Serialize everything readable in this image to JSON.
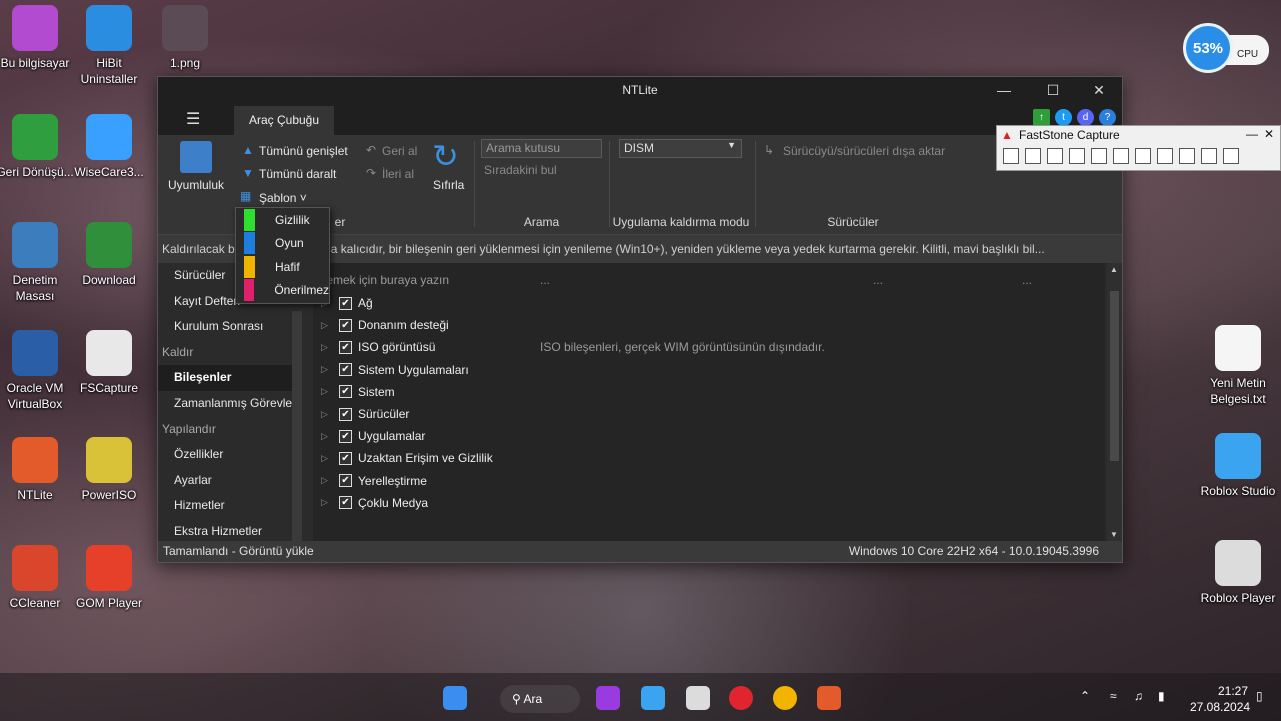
{
  "desktop_icons_left": [
    {
      "label": "Bu bilgisayar",
      "color": "#b34bd1",
      "icon": "monitor-icon"
    },
    {
      "label": "HiBit Uninstaller",
      "color": "#2a8de0",
      "icon": "hibit-icon"
    },
    {
      "label": "1.png",
      "color": "#5b4b55",
      "icon": "image-file-icon"
    },
    {
      "label": "Geri Dönüşü...",
      "color": "#2e9e3e",
      "icon": "recycle-bin-icon"
    },
    {
      "label": "WiseCare3...",
      "color": "#3aa0ff",
      "icon": "wisecare-icon"
    },
    {
      "label": "Denetim Masası",
      "color": "#3c7dbd",
      "icon": "control-panel-icon"
    },
    {
      "label": "Download",
      "color": "#2f8f3a",
      "icon": "download-icon"
    },
    {
      "label": "Oracle VM VirtualBox",
      "color": "#2a5fa8",
      "icon": "virtualbox-icon"
    },
    {
      "label": "FSCapture",
      "color": "#e8e8e8",
      "icon": "fscapture-icon"
    },
    {
      "label": "NTLite",
      "color": "#e35b2a",
      "icon": "ntlite-icon"
    },
    {
      "label": "PowerISO",
      "color": "#d9c237",
      "icon": "poweriso-icon"
    },
    {
      "label": "CCleaner",
      "color": "#d9462b",
      "icon": "ccleaner-icon"
    },
    {
      "label": "GOM Player",
      "color": "#e6402b",
      "icon": "gom-player-icon"
    }
  ],
  "desktop_icons_right": [
    {
      "label": "Yeni Metin Belgesi.txt",
      "color": "#f5f5f5",
      "icon": "text-file-icon"
    },
    {
      "label": "Roblox Studio",
      "color": "#3aa4f0",
      "icon": "roblox-studio-icon"
    },
    {
      "label": "Roblox Player",
      "color": "#dcdcdc",
      "icon": "roblox-player-icon"
    }
  ],
  "cpu_widget": {
    "percent": "53%",
    "label": "CPU"
  },
  "window": {
    "title": "NTLite",
    "tab": "Araç Çubuğu",
    "ribbon": {
      "compat": "Uyumluluk",
      "expand_all": "Tümünü genişlet",
      "collapse_all": "Tümünü daralt",
      "template": "Şablon",
      "undo": "Geri al",
      "redo": "İleri al",
      "reset": "Sıfırla",
      "filter_group": "er",
      "search_placeholder": "Arama kutusu",
      "find_next": "Sıradakini bul",
      "search_group": "Arama",
      "dism": "DISM",
      "removal_mode_group": "Uygulama kaldırma modu",
      "export_drivers": "Sürücüyü/sürücüleri dışa aktar",
      "drivers_group": "Sürücüler"
    },
    "infobar": "Kaldırılacak bil                                    kaldırın. Kaldırma kalıcıdır, bir bileşenin geri yüklenmesi için yenileme (Win10+), yeniden yükleme veya yedek kurtarma gerekir. Kilitli, mavi başlıklı bil...",
    "sidebar": [
      {
        "type": "item",
        "label": "Sürücüler"
      },
      {
        "type": "item",
        "label": "Kayıt Defteri"
      },
      {
        "type": "item",
        "label": "Kurulum Sonrası"
      },
      {
        "type": "head",
        "label": "Kaldır"
      },
      {
        "type": "active",
        "label": "Bileşenler"
      },
      {
        "type": "item",
        "label": "Zamanlanmış Görevler"
      },
      {
        "type": "head",
        "label": "Yapılandır"
      },
      {
        "type": "item",
        "label": "Özellikler"
      },
      {
        "type": "item",
        "label": "Ayarlar"
      },
      {
        "type": "item",
        "label": "Hizmetler"
      },
      {
        "type": "item",
        "label": "Ekstra Hizmetler"
      }
    ],
    "main_hint": "relemek için buraya yazın",
    "columns": [
      "...",
      "...",
      "..."
    ],
    "tree": [
      {
        "label": "Ağ",
        "desc": ""
      },
      {
        "label": "Donanım desteği",
        "desc": ""
      },
      {
        "label": "ISO görüntüsü",
        "desc": "ISO bileşenleri, gerçek WIM görüntüsünün dışındadır."
      },
      {
        "label": "Sistem Uygulamaları",
        "desc": ""
      },
      {
        "label": "Sistem",
        "desc": ""
      },
      {
        "label": "Sürücüler",
        "desc": ""
      },
      {
        "label": "Uygulamalar",
        "desc": ""
      },
      {
        "label": "Uzaktan Erişim ve Gizlilik",
        "desc": ""
      },
      {
        "label": "Yerelleştirme",
        "desc": ""
      },
      {
        "label": "Çoklu Medya",
        "desc": ""
      }
    ],
    "status_left": "Tamamlandı - Görüntü yükle",
    "status_right": "Windows 10 Core 22H2 x64 - 10.0.19045.3996"
  },
  "template_menu": [
    {
      "label": "Gizlilik",
      "color": "#2ee02e"
    },
    {
      "label": "Oyun",
      "color": "#1e7ee0"
    },
    {
      "label": "Hafif",
      "color": "#f0b400"
    },
    {
      "label": "Önerilmez",
      "color": "#e0206a"
    }
  ],
  "faststone": {
    "title": "FastStone Capture"
  },
  "taskbar": {
    "search": "Ara",
    "time": "21:27",
    "date": "27.08.2024"
  }
}
